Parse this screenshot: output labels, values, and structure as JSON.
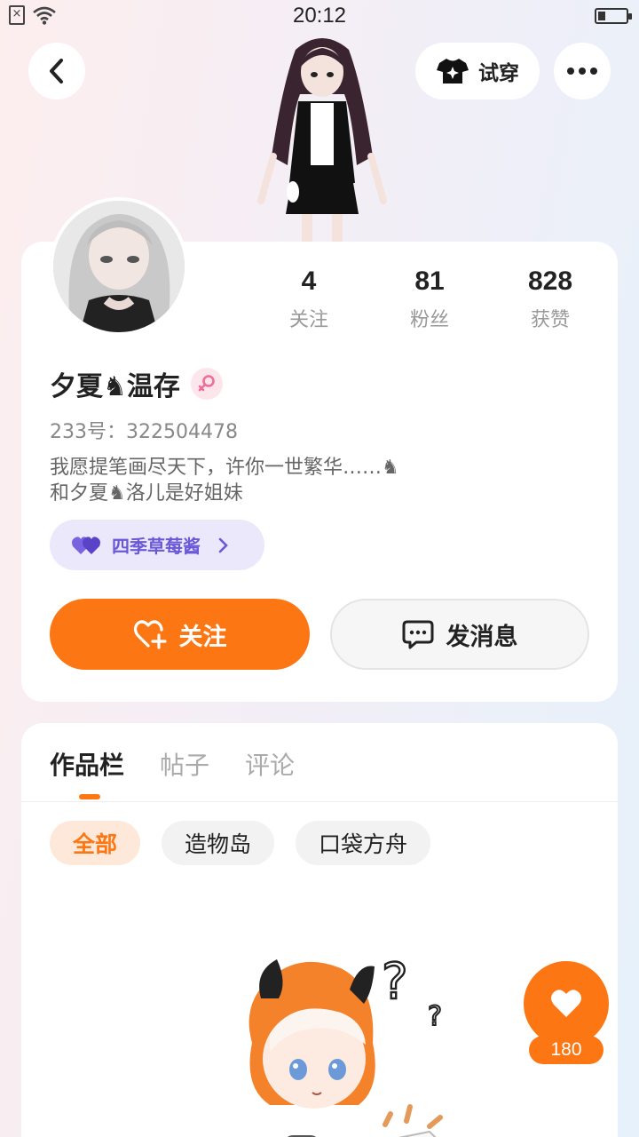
{
  "status_bar": {
    "time": "20:12",
    "sim_icon": "sim-off-icon",
    "wifi_icon": "wifi-icon",
    "battery_level": 0.25
  },
  "header": {
    "back_icon": "chevron-left-icon",
    "tryon_label": "试穿",
    "tryon_icon": "tshirt-sparkle-icon",
    "more_icon": "more-dots-icon"
  },
  "profile": {
    "name": "夕夏♞温存",
    "gender_icon": "female-icon",
    "uid": "233号：322504478",
    "bio_lines": [
      "我愿提笔画尽天下，许你一世繁华……♞",
      "和夕夏♞洛儿是好姐妹"
    ],
    "group_label": "四季草莓酱",
    "stats": [
      {
        "value": "4",
        "label": "关注"
      },
      {
        "value": "81",
        "label": "粉丝"
      },
      {
        "value": "828",
        "label": "获赞"
      }
    ],
    "follow_label": "关注",
    "message_label": "发消息"
  },
  "tabs": [
    {
      "label": "作品栏",
      "active": true
    },
    {
      "label": "帖子",
      "active": false
    },
    {
      "label": "评论",
      "active": false
    }
  ],
  "filters": [
    {
      "label": "全部",
      "active": true
    },
    {
      "label": "造物岛",
      "active": false
    },
    {
      "label": "口袋方舟",
      "active": false
    }
  ],
  "like": {
    "count": "180",
    "icon": "heart-icon"
  },
  "colors": {
    "accent": "#fc7713",
    "group_purple": "#6b58d6",
    "female_pink": "#f06c9b"
  }
}
